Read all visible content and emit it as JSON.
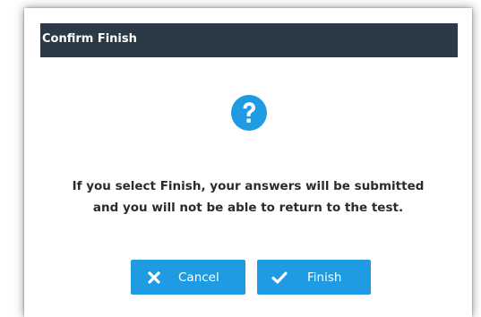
{
  "dialog": {
    "title": "Confirm Finish",
    "icon": "question-circle-icon",
    "message_line1": "If you select Finish, your answers will be submitted",
    "message_line2": "and you will not be able to return to the test.",
    "buttons": {
      "cancel_label": "Cancel",
      "cancel_icon": "close-x-icon",
      "finish_label": "Finish",
      "finish_icon": "checkmark-icon"
    }
  },
  "colors": {
    "header_background": "#2c3a48",
    "accent": "#1e9be2",
    "message_text": "#2b2b2b"
  }
}
